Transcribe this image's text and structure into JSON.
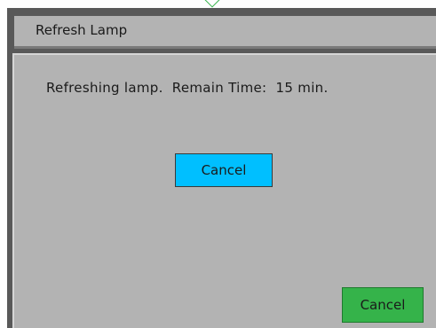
{
  "dialog": {
    "title": "Refresh Lamp",
    "message": "Refreshing lamp.  Remain Time:  15 min.",
    "cancel_primary_label": "Cancel",
    "cancel_secondary_label": "Cancel"
  },
  "colors": {
    "frame": "#595959",
    "panel": "#b3b3b3",
    "primary_button": "#00bfff",
    "secondary_button": "#35b34a"
  }
}
